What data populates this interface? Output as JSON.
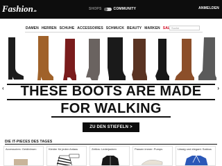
{
  "header": {
    "logo": "Fashion",
    "logo_suffix": ".de",
    "switch": {
      "left_label": "SHOPS",
      "right_label": "COMMUNITY"
    },
    "login_label": "ANMELDEN"
  },
  "nav": {
    "items": [
      "DAMEN",
      "HERREN",
      "SCHUHE",
      "ACCESSOIRES",
      "SCHMUCK",
      "BEAUTY",
      "MARKEN",
      "SALE"
    ],
    "search_placeholder": "Suche"
  },
  "banner": {
    "boot_colors": [
      "#1c1c1c",
      "#a0622a",
      "#7a1c1c",
      "#6a6360",
      "#1a1a1a",
      "#5a3322",
      "#181818",
      "#8c4f2a",
      "#5a5a5a"
    ],
    "headline_line1": "THESE BOOTS ARE MADE",
    "headline_line2": "FOR WALKING",
    "cta_label": "ZU DEN STIEFELN >",
    "prev_icon": "‹",
    "next_icon": "›"
  },
  "section": {
    "title": "DIE IT-PIECES DES TAGES",
    "cards": [
      {
        "caption": "Accessoires: Geldbörsen"
      },
      {
        "caption": "Kleider für jeden Anlass"
      },
      {
        "caption": "Zeitlos: Lederjacken"
      },
      {
        "caption": "Passen immer: Pumps"
      },
      {
        "caption": "Lässig und elegant: Sakkos"
      }
    ]
  }
}
